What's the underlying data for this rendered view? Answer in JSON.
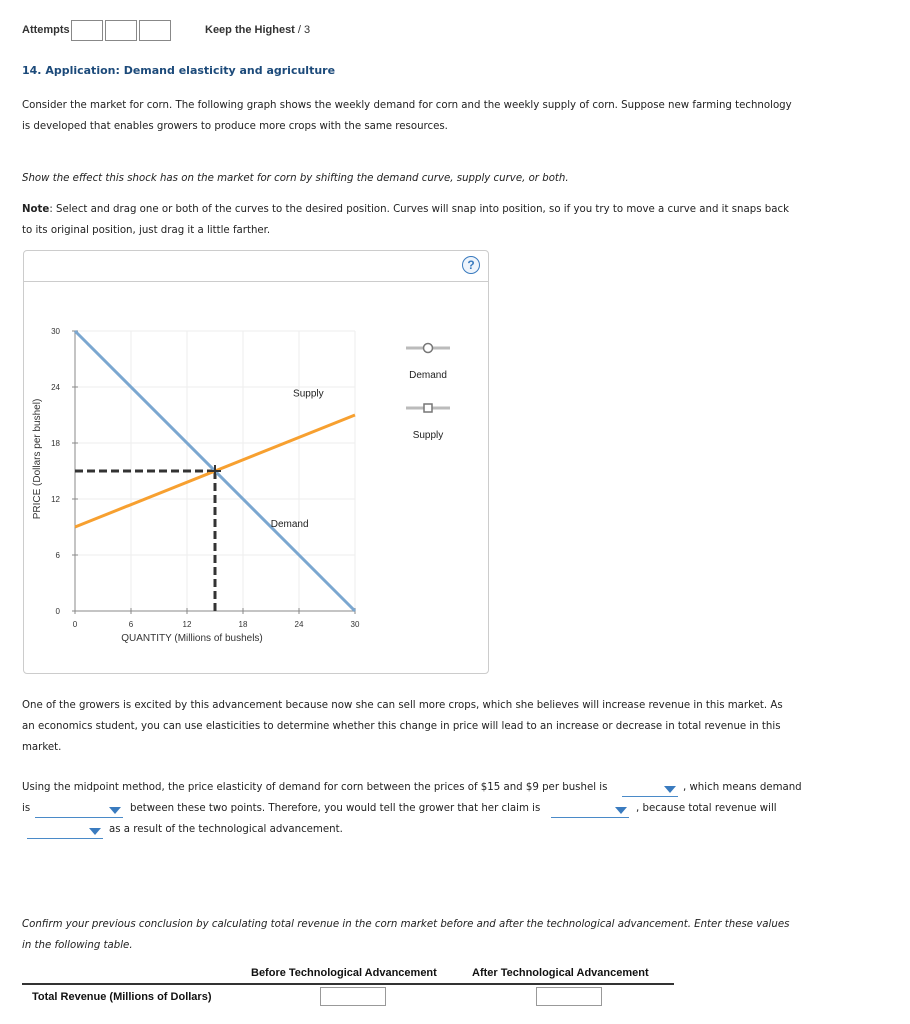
{
  "header": {
    "attempts_label": "Attempts",
    "attempt_boxes": 3,
    "keep_label": "Keep the Highest",
    "keep_value": "/ 3"
  },
  "question": {
    "title": "14. Application: Demand elasticity and agriculture",
    "intro_line1": "Consider the market for corn. The following graph shows the weekly demand for corn and the weekly supply of corn. Suppose new farming technology",
    "intro_line2": "is developed that enables growers to produce more crops with the same resources.",
    "instruction": "Show the effect this shock has on the market for corn by shifting the demand curve, supply curve, or both.",
    "note_label": "Note",
    "note_line1": ": Select and drag one or both of the curves to the desired position. Curves will snap into position, so if you try to move a curve and it snaps back",
    "note_line2": "to its original position, just drag it a little farther."
  },
  "graph": {
    "help_label": "?",
    "legend": [
      {
        "label": "Demand",
        "marker": "circle"
      },
      {
        "label": "Supply",
        "marker": "square"
      }
    ]
  },
  "chart_data": {
    "type": "line",
    "xlabel": "QUANTITY (Millions of bushels)",
    "ylabel": "PRICE (Dollars per bushel)",
    "xlim": [
      0,
      30
    ],
    "ylim": [
      0,
      30
    ],
    "xticks": [
      0,
      6,
      12,
      18,
      24,
      30
    ],
    "yticks": [
      0,
      6,
      12,
      18,
      24,
      30
    ],
    "grid": true,
    "series": [
      {
        "name": "Demand",
        "color": "#7ba7d0",
        "points": [
          [
            0,
            30
          ],
          [
            30,
            0
          ]
        ],
        "label": "Demand",
        "label_at": [
          23,
          9
        ]
      },
      {
        "name": "Supply",
        "color": "#f7a030",
        "points": [
          [
            0,
            9
          ],
          [
            30,
            21
          ]
        ],
        "label": "Supply",
        "label_at": [
          25,
          23
        ]
      }
    ],
    "equilibrium": {
      "x": 15,
      "y": 15,
      "dashed_guides": true
    }
  },
  "followup": {
    "p1_line1": "One of the growers is excited by this advancement because now she can sell more crops, which she believes will increase revenue in this market. As",
    "p1_line2": "an economics student, you can use elasticities to determine whether this change in price will lead to an increase or decrease in total revenue in this",
    "p1_line3": "market.",
    "s1": "Using the midpoint method, the price elasticity of demand for corn between the prices of $15 and $9 per bushel is",
    "s2": ", which means demand",
    "s3": "is",
    "s4": "between these two points. Therefore, you would tell the grower that her claim is",
    "s5": ", because total revenue will",
    "s6": "as a result of the technological advancement.",
    "dropdowns": [
      "",
      "",
      "",
      ""
    ]
  },
  "confirm": {
    "line1": "Confirm your previous conclusion by calculating total revenue in the corn market before and after the technological advancement. Enter these values",
    "line2": "in the following table."
  },
  "table": {
    "col_before": "Before Technological Advancement",
    "col_after": "After Technological Advancement",
    "row_label": "Total Revenue (Millions of Dollars)",
    "before_value": "",
    "after_value": ""
  }
}
